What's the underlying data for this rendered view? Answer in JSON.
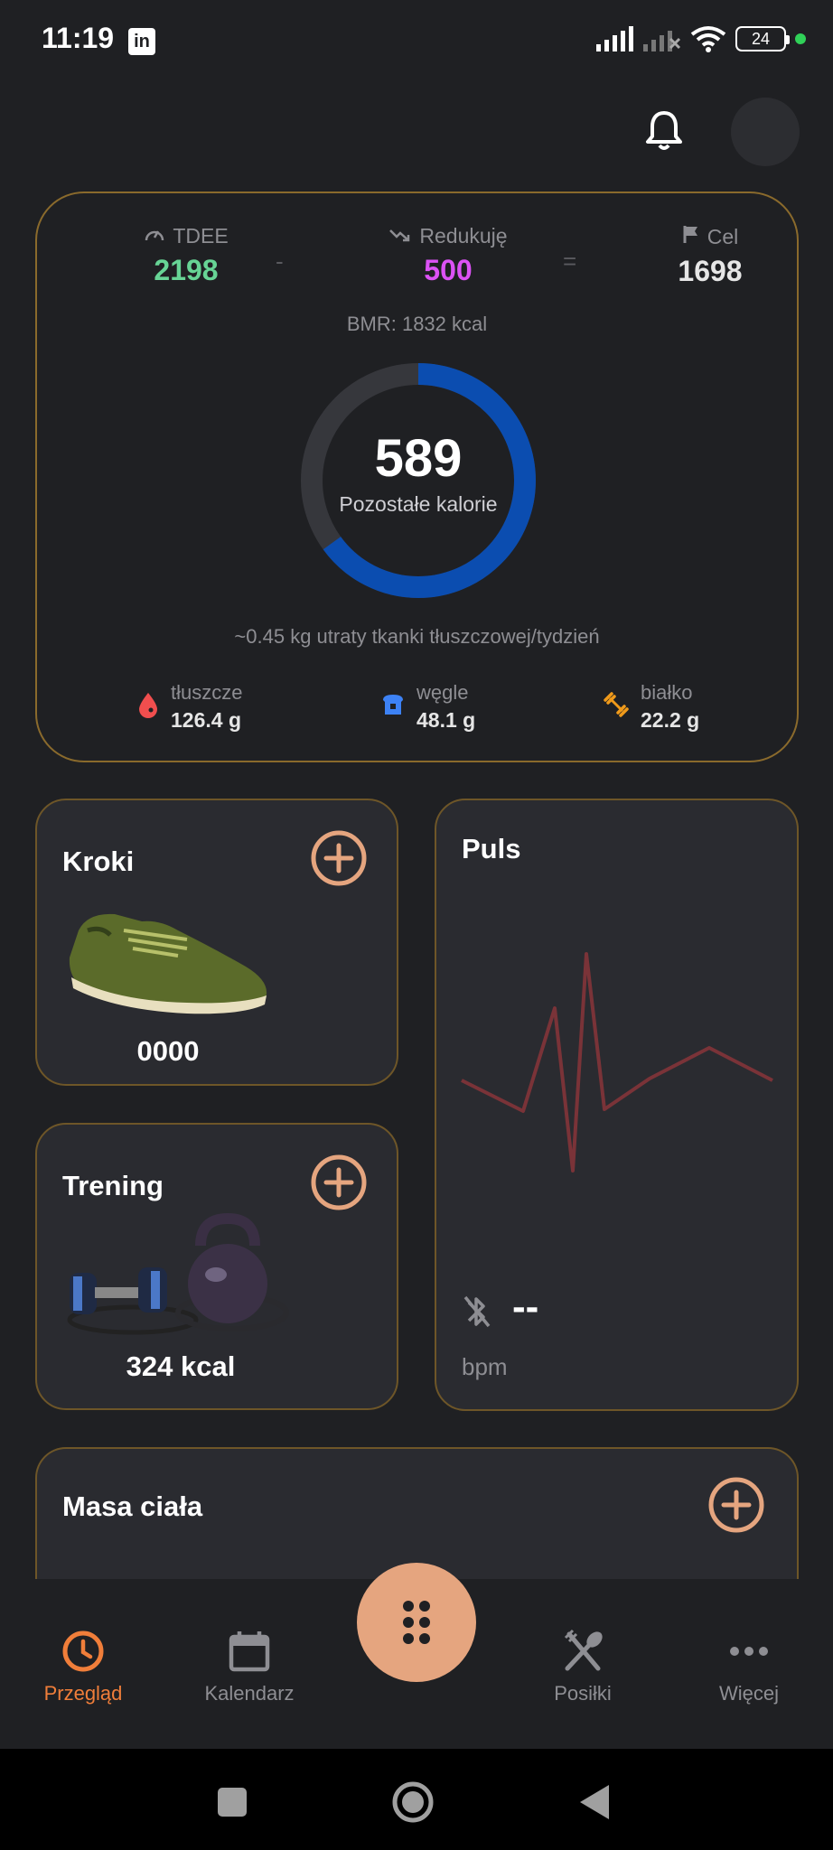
{
  "status_bar": {
    "time": "11:19",
    "battery": "24",
    "linkedin": "in"
  },
  "calories": {
    "tdee_label": "TDEE",
    "tdee_value": "2198",
    "minus": "-",
    "reduction_label": "Redukuję",
    "reduction_value": "500",
    "equals": "=",
    "goal_label": "Cel",
    "goal_value": "1698",
    "bmr": "BMR: 1832 kcal",
    "remaining_value": "589",
    "remaining_label": "Pozostałe kalorie",
    "remaining_fraction": 0.65,
    "loss_text": "~0.45 kg utraty tkanki tłuszczowej/tydzień",
    "macros": [
      {
        "label": "tłuszcze",
        "value": "126.4 g"
      },
      {
        "label": "węgle",
        "value": "48.1 g"
      },
      {
        "label": "białko",
        "value": "22.2 g"
      }
    ]
  },
  "steps": {
    "title": "Kroki",
    "value": "0000"
  },
  "training": {
    "title": "Trening",
    "value": "324 kcal"
  },
  "pulse": {
    "title": "Puls",
    "value": "--",
    "unit": "bpm"
  },
  "weight": {
    "title": "Masa ciała"
  },
  "nav": {
    "items": [
      {
        "label": "Przegląd"
      },
      {
        "label": "Kalendarz"
      },
      {
        "label": "Posiłki"
      },
      {
        "label": "Więcej"
      }
    ]
  },
  "colors": {
    "accent": "#f07e3a",
    "tdee": "#67d495",
    "reduction": "#dc52f5",
    "ring": "#0b4db0",
    "card_border": "#8a6a2c",
    "fab": "#e5a57f"
  }
}
